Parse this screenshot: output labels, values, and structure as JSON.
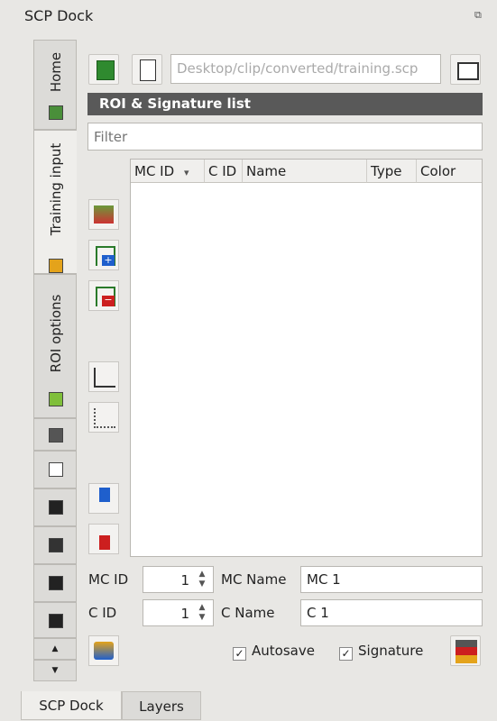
{
  "window": {
    "title": "SCP Dock",
    "float_icon": "float-icon",
    "close_icon": "close-icon"
  },
  "vtabs": [
    {
      "label": "Home",
      "icon": "home-icon"
    },
    {
      "label": "Training input",
      "icon": "training-icon"
    },
    {
      "label": "ROI options",
      "icon": "roi-options-icon"
    }
  ],
  "toolbar": {
    "path_value": "Desktop/clip/converted/training.scp"
  },
  "roi_panel": {
    "title": "ROI & Signature list",
    "filter_placeholder": "Filter"
  },
  "table": {
    "columns": [
      "MC ID",
      "C ID",
      "Name",
      "Type",
      "Color"
    ],
    "sort_indicator": "▾",
    "rows": []
  },
  "fields": {
    "mc_id_label": "MC ID",
    "mc_id_value": "1",
    "mc_name_label": "MC Name",
    "mc_name_value": "MC 1",
    "c_id_label": "C ID",
    "c_id_value": "1",
    "c_name_label": "C Name",
    "c_name_value": "C 1"
  },
  "checkboxes": {
    "autosave": "Autosave",
    "signature": "Signature",
    "check_mark": "✓"
  },
  "bottom_tabs": [
    "SCP Dock",
    "Layers"
  ],
  "colors": {
    "header_bar": "#595959",
    "icon_green": "#3a9a2e",
    "icon_red": "#cc1f1f",
    "icon_blue": "#1f5fcc"
  }
}
